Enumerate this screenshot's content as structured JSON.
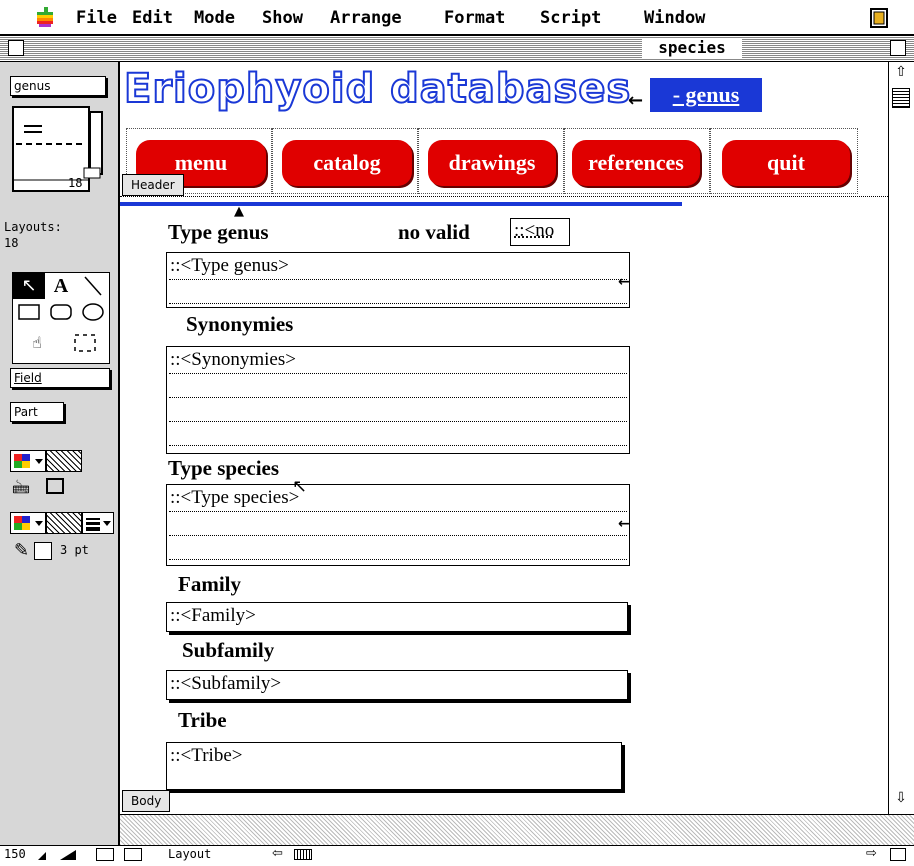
{
  "menubar": {
    "items": [
      "File",
      "Edit",
      "Mode",
      "Show",
      "Arrange",
      "Format",
      "Script",
      "Window"
    ]
  },
  "window": {
    "title": "species"
  },
  "palette": {
    "layout_selector": "genus",
    "book_page": "18",
    "layouts_label": "Layouts:",
    "layouts_count": "18",
    "field_button": "Field",
    "part_button": "Part",
    "line_width": "3 pt"
  },
  "layout": {
    "headline": "Eriophyoid databases",
    "headline_suffix": "- genus",
    "nav_buttons": [
      "menu",
      "catalog",
      "drawings",
      "references",
      "quit"
    ],
    "parts": {
      "header": "Header",
      "body": "Body"
    },
    "labels": {
      "type_genus": "Type genus",
      "no_valid": "no valid",
      "synonymies": "Synonymies",
      "type_species": "Type species",
      "family": "Family",
      "subfamily": "Subfamily",
      "tribe": "Tribe"
    },
    "fields": {
      "no_valid": "::<no",
      "type_genus": "::<Type genus>",
      "synonymies": "::<Synonymies>",
      "type_species": "::<Type species>",
      "family": "::<Family>",
      "subfamily": "::<Subfamily>",
      "tribe": "::<Tribe>"
    }
  },
  "status": {
    "zoom": "150",
    "mode": "Layout"
  },
  "colors": {
    "brand_blue": "#1a38d6",
    "button_red": "#e00000",
    "palette_gray": "#d7d7d7"
  }
}
